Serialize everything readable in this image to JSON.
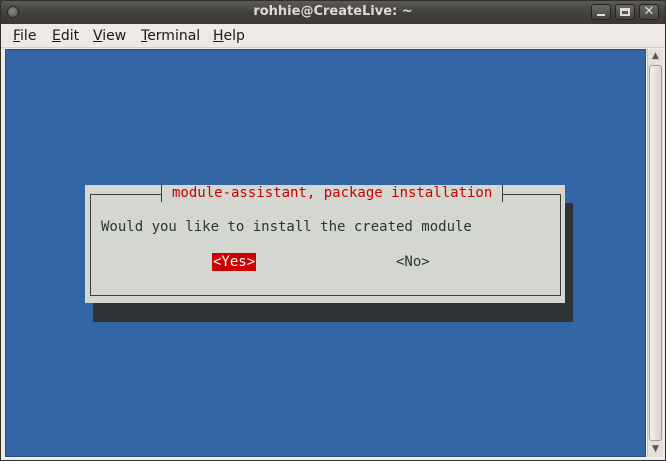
{
  "window": {
    "title": "rohhie@CreateLive: ~"
  },
  "menubar": {
    "items": [
      {
        "accel": "F",
        "rest": "ile"
      },
      {
        "accel": "E",
        "rest": "dit"
      },
      {
        "accel": "V",
        "rest": "iew"
      },
      {
        "accel": "T",
        "rest": "erminal"
      },
      {
        "accel": "H",
        "rest": "elp"
      }
    ]
  },
  "window_buttons": {
    "close_glyph": "✕"
  },
  "dialog": {
    "title": "module-assistant, package installation",
    "message": "Would you like to install the created module",
    "yes_label": "<Yes>",
    "no_label": "<No>",
    "selected": "yes"
  },
  "colors": {
    "terminal_bg": "#3465a4",
    "dialog_bg": "#d3d7cf",
    "dialog_title": "#cc0000",
    "selected_button_bg": "#cc0000",
    "shadow": "#2e3436"
  }
}
